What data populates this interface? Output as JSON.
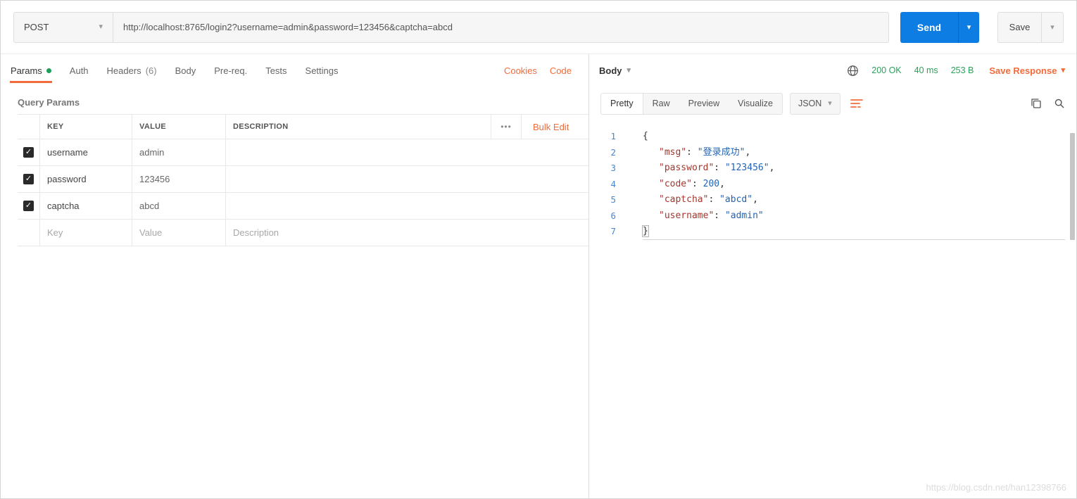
{
  "request_bar": {
    "method": "POST",
    "url": "http://localhost:8765/login2?username=admin&password=123456&captcha=abcd",
    "send": "Send",
    "save": "Save"
  },
  "request_tabs": {
    "params": "Params",
    "auth": "Auth",
    "headers": "Headers",
    "headers_count": "(6)",
    "body": "Body",
    "pre_request": "Pre-req.",
    "tests": "Tests",
    "settings": "Settings",
    "cookies_link": "Cookies",
    "code_link": "Code"
  },
  "query_params": {
    "title": "Query Params",
    "columns": {
      "key": "KEY",
      "value": "VALUE",
      "description": "DESCRIPTION"
    },
    "bulk_edit": "Bulk Edit",
    "rows": [
      {
        "key": "username",
        "value": "admin",
        "description": "",
        "checked": true
      },
      {
        "key": "password",
        "value": "123456",
        "description": "",
        "checked": true
      },
      {
        "key": "captcha",
        "value": "abcd",
        "description": "",
        "checked": true
      }
    ],
    "new_row_placeholders": {
      "key": "Key",
      "value": "Value",
      "description": "Description"
    }
  },
  "response": {
    "body_dropdown": "Body",
    "status": "200 OK",
    "time": "40 ms",
    "size": "253 B",
    "save_response": "Save Response",
    "tabs": {
      "pretty": "Pretty",
      "raw": "Raw",
      "preview": "Preview",
      "visualize": "Visualize"
    },
    "format_dropdown": "JSON",
    "viewer": {
      "line_numbers": [
        "1",
        "2",
        "3",
        "4",
        "5",
        "6",
        "7"
      ],
      "open_brace": "{",
      "close_brace": "}",
      "entries": [
        {
          "key": "\"msg\"",
          "sep": ": ",
          "value": "\"登录成功\"",
          "comma": ","
        },
        {
          "key": "\"password\"",
          "sep": ": ",
          "value": "\"123456\"",
          "comma": ","
        },
        {
          "key": "\"code\"",
          "sep": ": ",
          "value": "200",
          "comma": ","
        },
        {
          "key": "\"captcha\"",
          "sep": ": ",
          "value": "\"abcd\"",
          "comma": ","
        },
        {
          "key": "\"username\"",
          "sep": ": ",
          "value": "\"admin\"",
          "comma": ""
        }
      ]
    }
  },
  "icons": {
    "chevron_down": "▾",
    "check": "✓",
    "more_options": "•••"
  },
  "watermark": "https://blog.csdn.net/han12398766",
  "colors": {
    "accent_orange": "#f26b3a",
    "send_blue": "#0d7de3",
    "status_green": "#29a35a",
    "json_key": "#a5362e",
    "json_value": "#2264b5"
  }
}
